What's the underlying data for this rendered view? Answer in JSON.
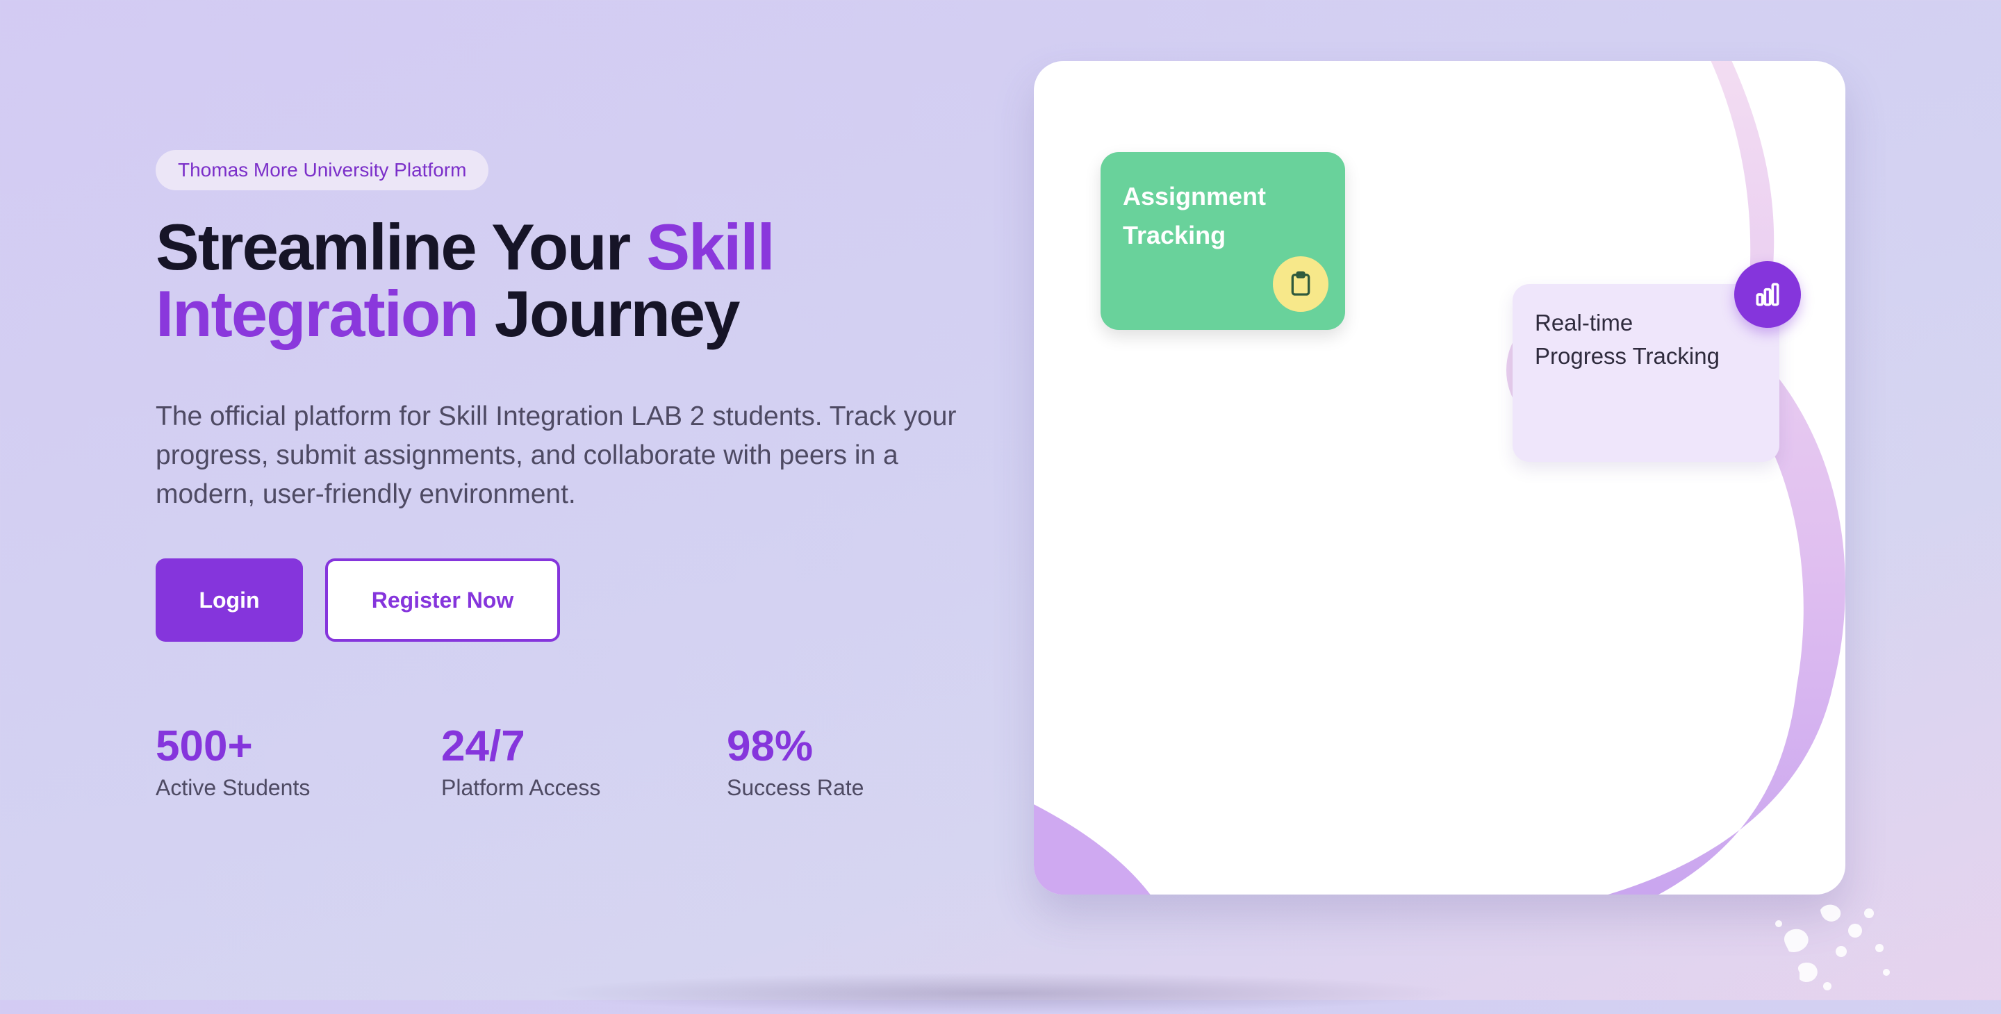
{
  "hero": {
    "badge": "Thomas More University Platform",
    "title_part1": "Streamline Your ",
    "title_accent": "Skill Integration",
    "title_part2": " Journey",
    "description": "The official platform for Skill Integration LAB 2 students. Track your progress, submit assignments, and collaborate with peers in a modern, user-friendly environment.",
    "login_label": "Login",
    "register_label": "Register Now"
  },
  "stats": [
    {
      "value": "500+",
      "label": "Active Students"
    },
    {
      "value": "24/7",
      "label": "Platform Access"
    },
    {
      "value": "98%",
      "label": "Success Rate"
    }
  ],
  "feature_card": {
    "assignment_title": "Assignment Tracking",
    "assignment_icon": "clipboard-icon",
    "progress_title_line1": "Real-time",
    "progress_title_line2": "Progress Tracking",
    "progress_icon": "bar-chart-icon"
  },
  "colors": {
    "accent": "#8535dc",
    "green_tile": "#69d29b",
    "lilac_tile": "#efe6fb",
    "badge_yellow": "#f7e88a"
  }
}
